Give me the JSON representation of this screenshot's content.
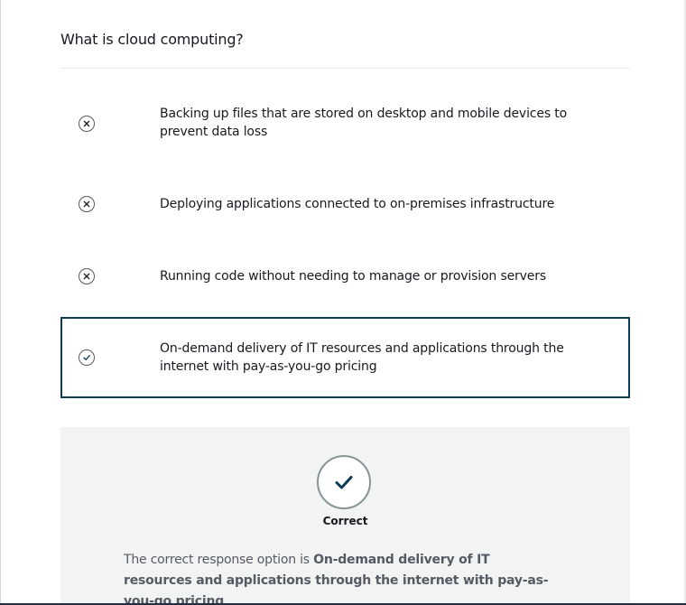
{
  "quiz": {
    "question": "What is cloud computing?",
    "options": [
      {
        "label": "Backing up files that are stored on desktop and mobile devices to prevent data loss",
        "state": "incorrect",
        "icon": "x-circle-icon"
      },
      {
        "label": "Deploying applications connected to on-premises infrastructure",
        "state": "incorrect",
        "icon": "x-circle-icon"
      },
      {
        "label": "Running code without needing to manage or provision servers",
        "state": "incorrect",
        "icon": "x-circle-icon"
      },
      {
        "label": "On-demand delivery of IT resources and applications through the internet with pay-as-you-go pricing",
        "state": "correct",
        "icon": "check-circle-icon"
      }
    ],
    "feedback": {
      "result_icon": "checkmark-icon",
      "result_label": "Correct",
      "explanation_prefix": "The correct response option is ",
      "explanation_answer": "On-demand delivery of IT resources and applications through the internet with pay-as-you-go pricing",
      "explanation_suffix": "."
    }
  },
  "colors": {
    "selected_border": "#0d3d55",
    "checkmark": "#0d3d55",
    "feedback_background": "#f2f3f3",
    "text": "#16191f",
    "muted_text": "#545b64"
  }
}
